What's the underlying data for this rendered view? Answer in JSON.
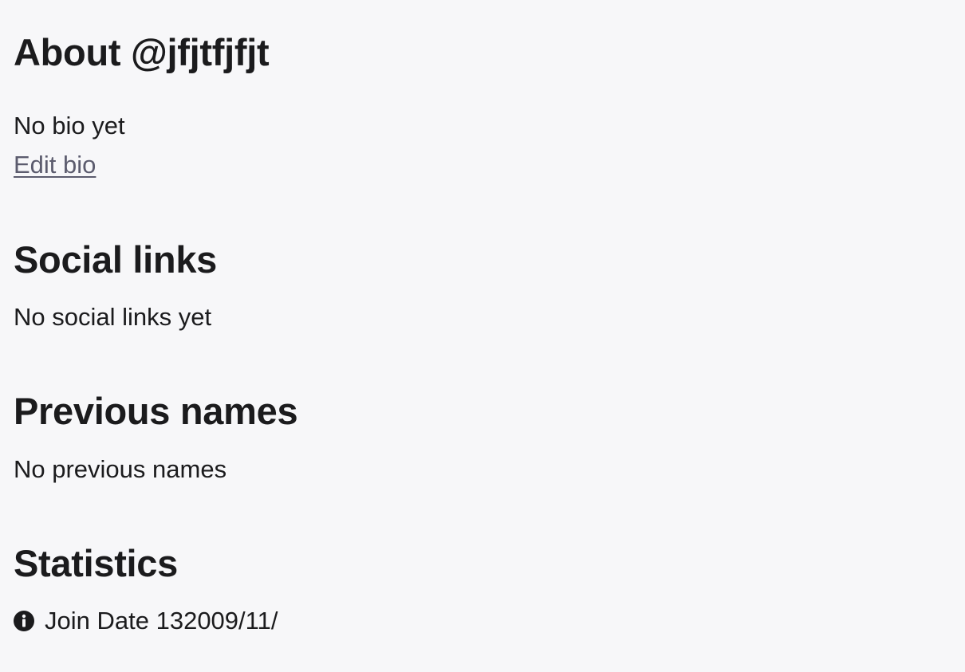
{
  "about": {
    "heading": "About @jfjtfjfjt",
    "bio_text": "No bio yet",
    "edit_bio_label": "Edit bio"
  },
  "social_links": {
    "heading": "Social links",
    "empty_text": "No social links yet"
  },
  "previous_names": {
    "heading": "Previous names",
    "empty_text": "No previous names"
  },
  "statistics": {
    "heading": "Statistics",
    "join_date_label": "Join Date",
    "join_date_value": "132009/11/",
    "icon": "info-icon"
  },
  "colors": {
    "background": "#f7f7f9",
    "text": "#1b1b1d",
    "link": "#5c5c6e"
  }
}
